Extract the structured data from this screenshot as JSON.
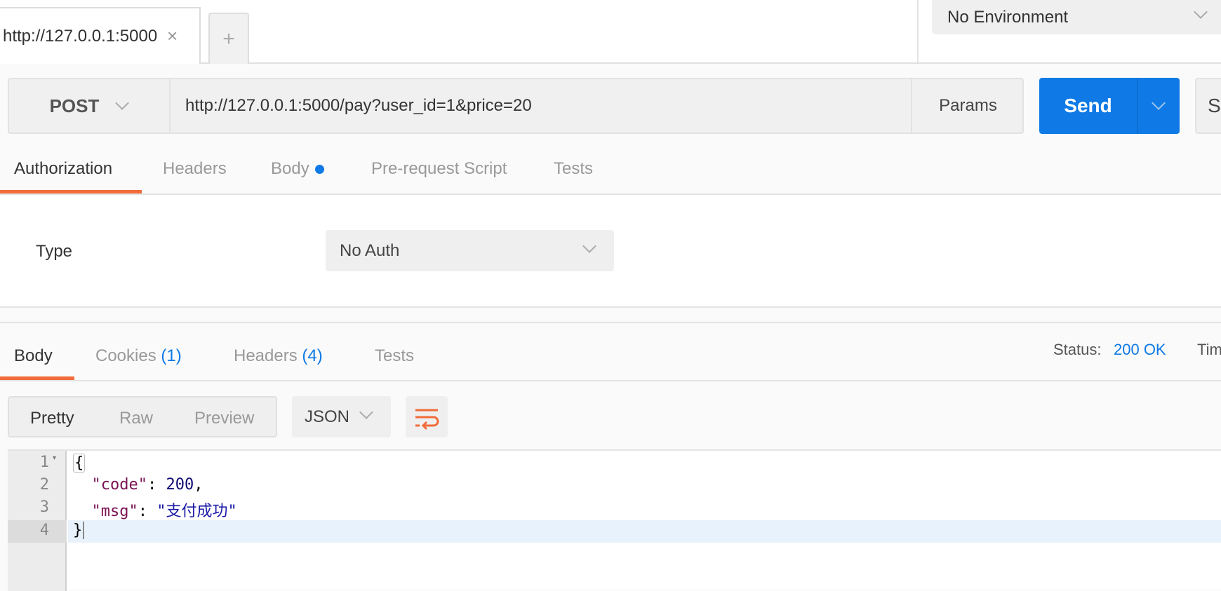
{
  "tabs": {
    "active_tab": "http://127.0.0.1:5000",
    "close": "×",
    "new_tab": "+"
  },
  "environment": {
    "selected": "No Environment"
  },
  "request": {
    "method": "POST",
    "url": "http://127.0.0.1:5000/pay?user_id=1&price=20",
    "params_label": "Params",
    "send_label": "Send",
    "save_label": "Sa"
  },
  "request_tabs": [
    {
      "label": "Authorization",
      "active": true
    },
    {
      "label": "Headers"
    },
    {
      "label": "Body",
      "has_dot": true
    },
    {
      "label": "Pre-request Script"
    },
    {
      "label": "Tests"
    }
  ],
  "auth": {
    "type_label": "Type",
    "type_value": "No Auth"
  },
  "response_tabs": {
    "body": "Body",
    "cookies": "Cookies",
    "cookies_count": "(1)",
    "headers": "Headers",
    "headers_count": "(4)",
    "tests": "Tests"
  },
  "status": {
    "label": "Status:",
    "value": "200 OK",
    "time_label": "Tim"
  },
  "view": {
    "pretty": "Pretty",
    "raw": "Raw",
    "preview": "Preview",
    "format": "JSON"
  },
  "response_body": {
    "line_numbers": [
      "1",
      "2",
      "3",
      "4"
    ],
    "open": "{",
    "key1": "\"code\"",
    "val1": "200",
    "key2": "\"msg\"",
    "val2": "\"支付成功\"",
    "close": "}"
  },
  "colors": {
    "accent": "#f26b3a",
    "send": "#0f7ae5"
  }
}
